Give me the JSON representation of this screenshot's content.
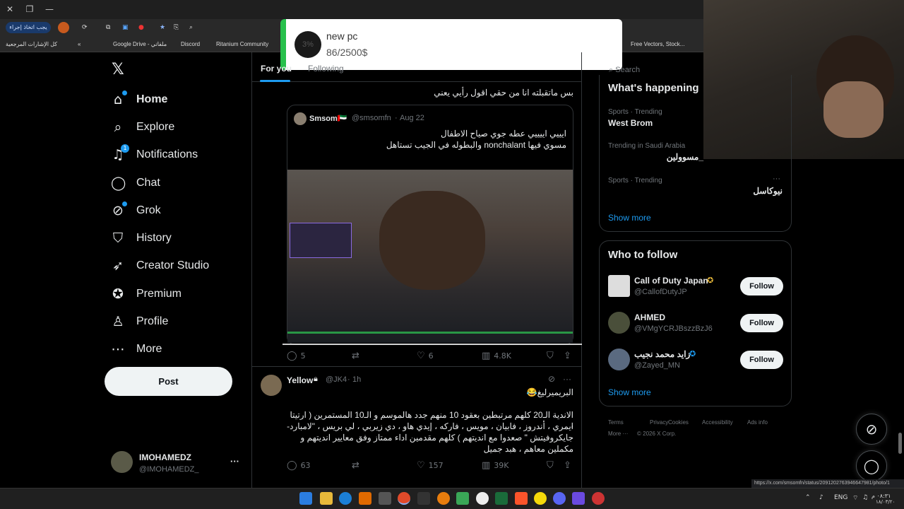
{
  "browser": {
    "toolbar_pill": "يجب اتخاذ إجراء",
    "bookmarks": [
      "كل الإشارات المرجعية",
      "Google Drive - ملفاتي",
      "Discord",
      "Ritanium Community",
      "Free Vectors, Stock..."
    ]
  },
  "toast": {
    "badge": "3%",
    "title": "new pc",
    "subtitle": "86/2500$"
  },
  "sidebar": {
    "items": [
      {
        "label": "Home",
        "icon": "home-icon"
      },
      {
        "label": "Explore",
        "icon": "search-icon"
      },
      {
        "label": "Notifications",
        "icon": "bell-icon",
        "badge": "1"
      },
      {
        "label": "Chat",
        "icon": "chat-icon"
      },
      {
        "label": "Grok",
        "icon": "grok-icon"
      },
      {
        "label": "History",
        "icon": "bookmark-icon"
      },
      {
        "label": "Creator Studio",
        "icon": "rocket-icon"
      },
      {
        "label": "Premium",
        "icon": "verified-icon"
      },
      {
        "label": "Profile",
        "icon": "person-icon"
      },
      {
        "label": "More",
        "icon": "more-circle-icon"
      }
    ],
    "post_label": "Post",
    "account": {
      "name": "IMOHAMEDZ",
      "handle": "@IMOHAMEDZ_"
    }
  },
  "feed": {
    "tabs": [
      "For you",
      "Following"
    ],
    "post1": {
      "text_line1": "بس ماتقبلته انا من حقي اقول رأيي يعني",
      "quote": {
        "name": "Smsom🇦🇪",
        "handle": "@smsomfn",
        "date": "Aug 22",
        "text_line1": "ايييي اييييي عطه جوي صياح الاطفال",
        "text_line2": "مسوي فيها nonchalant والبطوله في الجيب تستاهل"
      },
      "stats": {
        "replies": "5",
        "likes": "6",
        "views": "4.8K"
      }
    },
    "post2": {
      "name": "Yellow",
      "handle": "@JK4",
      "time": "1h",
      "line1": "البريميرليغ😂",
      "line2": "الاندية الـ20 كلهم مرتبطين بعقود 10 منهم جدد هالموسم و الـ10 المستمرين ( ارتيتا ،",
      "line3": "ايمري ، أندروز ، فابيان ، مويس ، فاركه ، إيدي هاو ، دي زيربي ، لي بريس ، \"لامبارد-",
      "line4": "جايكروفيتش \" صعدوا مع انديتهم ) كلهم مقدمين اداء ممتاز وفق معايير انديتهم و",
      "line5": "مكملين معاهم ، هبد جميل",
      "stats": {
        "replies": "63",
        "likes": "157",
        "views": "39K"
      }
    }
  },
  "right": {
    "search_placeholder": "Search",
    "happening_title": "What's happening",
    "trends": [
      {
        "meta": "Sports · Trending",
        "name": "West Brom"
      },
      {
        "meta": "Trending in Saudi Arabia",
        "name": "_مسوولين"
      },
      {
        "meta": "Sports · Trending",
        "name": "نيوكاسل"
      }
    ],
    "show_more": "Show more",
    "wtf_title": "Who to follow",
    "follow_label": "Follow",
    "follows": [
      {
        "name": "Call of Duty Japan",
        "handle": "@CallofDutyJP"
      },
      {
        "name": "AHMED",
        "handle": "@VMgYCRJBszzBzJ6"
      },
      {
        "name": "زايد محمد نجيب",
        "handle": "@Zayed_MN"
      }
    ],
    "footer": [
      "Terms",
      "Privacy",
      "Cookies",
      "Accessibility",
      "Ads info",
      "More ···",
      "© 2026 X Corp."
    ]
  },
  "status_url": "https://x.com/smsomfn/status/20912027639466479​81/photo/1",
  "taskbar": {
    "lang": "ENG",
    "time": "٠٨:٣١ م",
    "date": "١٨/٠٣/٢٠"
  },
  "colors": {
    "accent": "#1d9bf0",
    "toast_green": "#27c04b"
  }
}
